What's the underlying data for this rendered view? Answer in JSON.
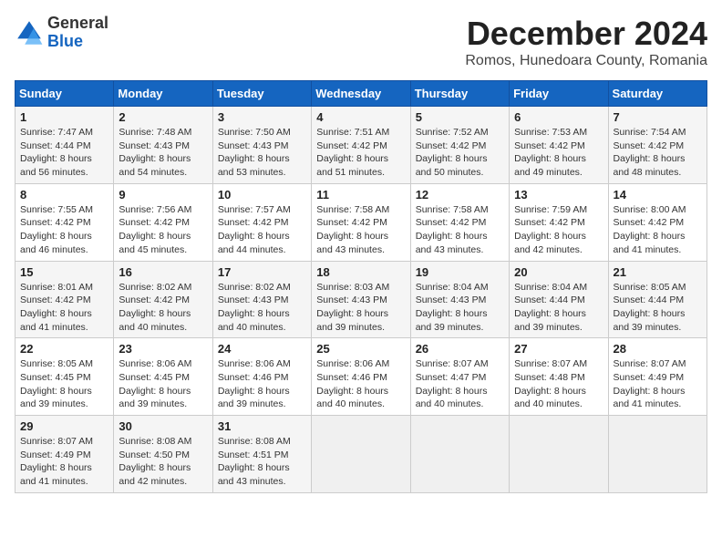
{
  "header": {
    "logo": {
      "line1": "General",
      "line2": "Blue"
    },
    "title": "December 2024",
    "location": "Romos, Hunedoara County, Romania"
  },
  "calendar": {
    "headers": [
      "Sunday",
      "Monday",
      "Tuesday",
      "Wednesday",
      "Thursday",
      "Friday",
      "Saturday"
    ],
    "weeks": [
      [
        {
          "day": "",
          "info": ""
        },
        {
          "day": "2",
          "info": "Sunrise: 7:48 AM\nSunset: 4:43 PM\nDaylight: 8 hours\nand 54 minutes."
        },
        {
          "day": "3",
          "info": "Sunrise: 7:50 AM\nSunset: 4:43 PM\nDaylight: 8 hours\nand 53 minutes."
        },
        {
          "day": "4",
          "info": "Sunrise: 7:51 AM\nSunset: 4:42 PM\nDaylight: 8 hours\nand 51 minutes."
        },
        {
          "day": "5",
          "info": "Sunrise: 7:52 AM\nSunset: 4:42 PM\nDaylight: 8 hours\nand 50 minutes."
        },
        {
          "day": "6",
          "info": "Sunrise: 7:53 AM\nSunset: 4:42 PM\nDaylight: 8 hours\nand 49 minutes."
        },
        {
          "day": "7",
          "info": "Sunrise: 7:54 AM\nSunset: 4:42 PM\nDaylight: 8 hours\nand 48 minutes."
        }
      ],
      [
        {
          "day": "8",
          "info": "Sunrise: 7:55 AM\nSunset: 4:42 PM\nDaylight: 8 hours\nand 46 minutes."
        },
        {
          "day": "9",
          "info": "Sunrise: 7:56 AM\nSunset: 4:42 PM\nDaylight: 8 hours\nand 45 minutes."
        },
        {
          "day": "10",
          "info": "Sunrise: 7:57 AM\nSunset: 4:42 PM\nDaylight: 8 hours\nand 44 minutes."
        },
        {
          "day": "11",
          "info": "Sunrise: 7:58 AM\nSunset: 4:42 PM\nDaylight: 8 hours\nand 43 minutes."
        },
        {
          "day": "12",
          "info": "Sunrise: 7:58 AM\nSunset: 4:42 PM\nDaylight: 8 hours\nand 43 minutes."
        },
        {
          "day": "13",
          "info": "Sunrise: 7:59 AM\nSunset: 4:42 PM\nDaylight: 8 hours\nand 42 minutes."
        },
        {
          "day": "14",
          "info": "Sunrise: 8:00 AM\nSunset: 4:42 PM\nDaylight: 8 hours\nand 41 minutes."
        }
      ],
      [
        {
          "day": "15",
          "info": "Sunrise: 8:01 AM\nSunset: 4:42 PM\nDaylight: 8 hours\nand 41 minutes."
        },
        {
          "day": "16",
          "info": "Sunrise: 8:02 AM\nSunset: 4:42 PM\nDaylight: 8 hours\nand 40 minutes."
        },
        {
          "day": "17",
          "info": "Sunrise: 8:02 AM\nSunset: 4:43 PM\nDaylight: 8 hours\nand 40 minutes."
        },
        {
          "day": "18",
          "info": "Sunrise: 8:03 AM\nSunset: 4:43 PM\nDaylight: 8 hours\nand 39 minutes."
        },
        {
          "day": "19",
          "info": "Sunrise: 8:04 AM\nSunset: 4:43 PM\nDaylight: 8 hours\nand 39 minutes."
        },
        {
          "day": "20",
          "info": "Sunrise: 8:04 AM\nSunset: 4:44 PM\nDaylight: 8 hours\nand 39 minutes."
        },
        {
          "day": "21",
          "info": "Sunrise: 8:05 AM\nSunset: 4:44 PM\nDaylight: 8 hours\nand 39 minutes."
        }
      ],
      [
        {
          "day": "22",
          "info": "Sunrise: 8:05 AM\nSunset: 4:45 PM\nDaylight: 8 hours\nand 39 minutes."
        },
        {
          "day": "23",
          "info": "Sunrise: 8:06 AM\nSunset: 4:45 PM\nDaylight: 8 hours\nand 39 minutes."
        },
        {
          "day": "24",
          "info": "Sunrise: 8:06 AM\nSunset: 4:46 PM\nDaylight: 8 hours\nand 39 minutes."
        },
        {
          "day": "25",
          "info": "Sunrise: 8:06 AM\nSunset: 4:46 PM\nDaylight: 8 hours\nand 40 minutes."
        },
        {
          "day": "26",
          "info": "Sunrise: 8:07 AM\nSunset: 4:47 PM\nDaylight: 8 hours\nand 40 minutes."
        },
        {
          "day": "27",
          "info": "Sunrise: 8:07 AM\nSunset: 4:48 PM\nDaylight: 8 hours\nand 40 minutes."
        },
        {
          "day": "28",
          "info": "Sunrise: 8:07 AM\nSunset: 4:49 PM\nDaylight: 8 hours\nand 41 minutes."
        }
      ],
      [
        {
          "day": "29",
          "info": "Sunrise: 8:07 AM\nSunset: 4:49 PM\nDaylight: 8 hours\nand 41 minutes."
        },
        {
          "day": "30",
          "info": "Sunrise: 8:08 AM\nSunset: 4:50 PM\nDaylight: 8 hours\nand 42 minutes."
        },
        {
          "day": "31",
          "info": "Sunrise: 8:08 AM\nSunset: 4:51 PM\nDaylight: 8 hours\nand 43 minutes."
        },
        {
          "day": "",
          "info": ""
        },
        {
          "day": "",
          "info": ""
        },
        {
          "day": "",
          "info": ""
        },
        {
          "day": "",
          "info": ""
        }
      ]
    ],
    "week0_day1": {
      "day": "1",
      "info": "Sunrise: 7:47 AM\nSunset: 4:44 PM\nDaylight: 8 hours\nand 56 minutes."
    }
  }
}
